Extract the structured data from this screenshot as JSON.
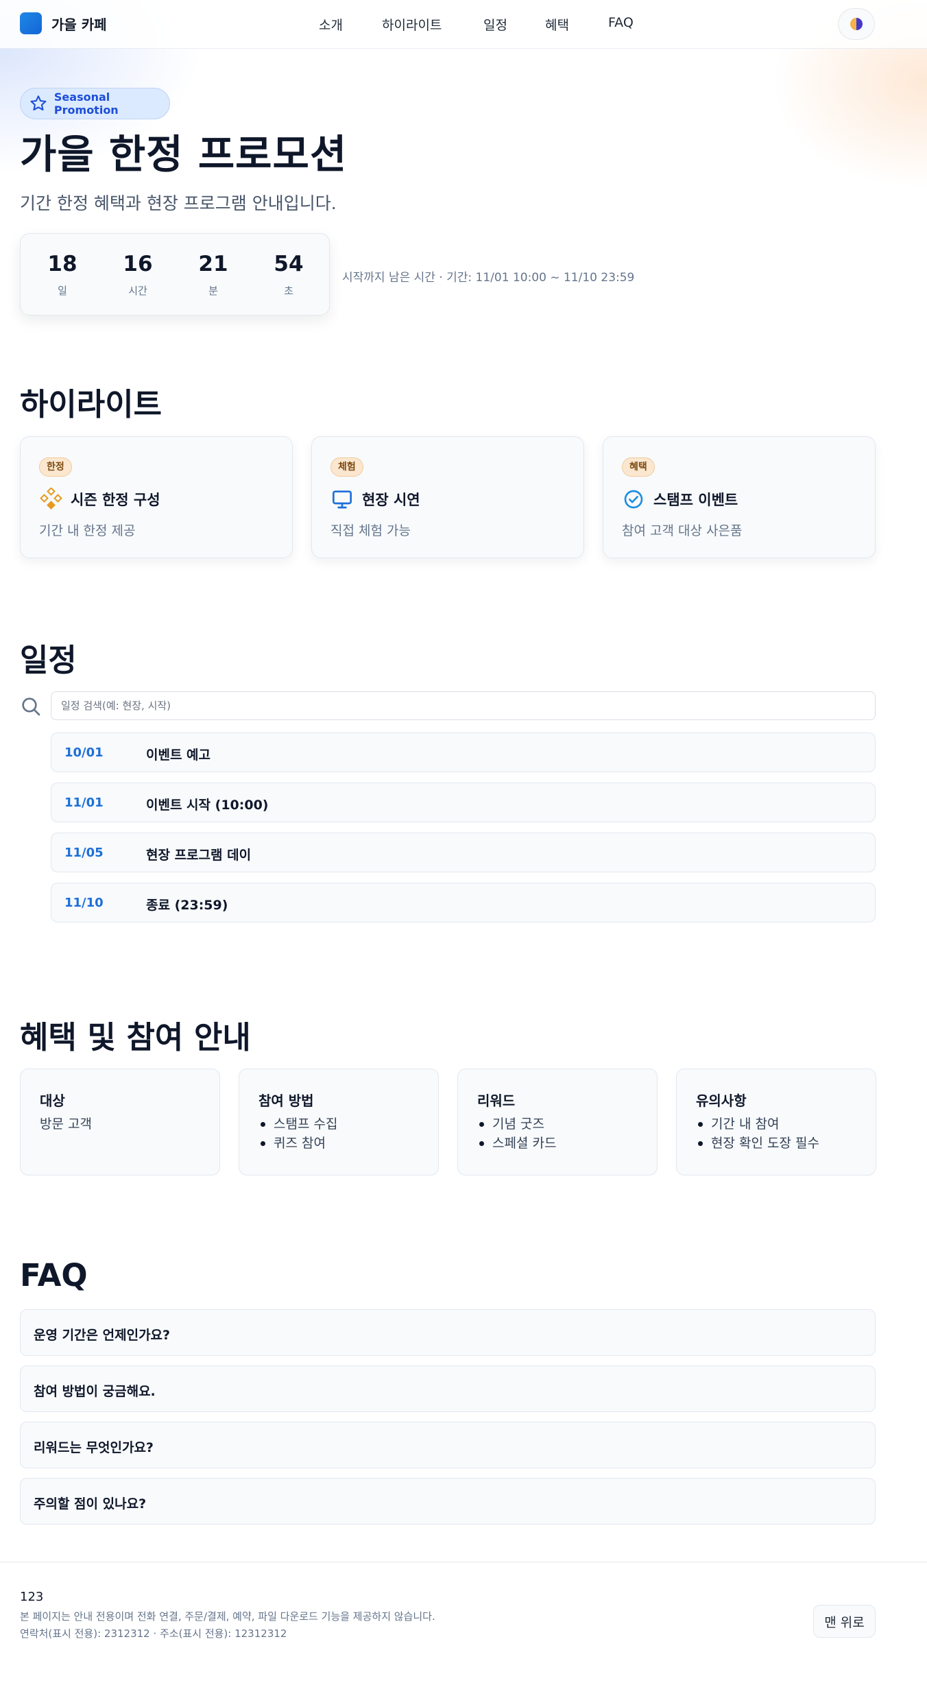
{
  "header": {
    "brand": "가을 카페",
    "nav": [
      "소개",
      "하이라이트",
      "일정",
      "혜택",
      "FAQ"
    ]
  },
  "hero": {
    "badge": "Seasonal Promotion",
    "title": "가을 한정 프로모션",
    "subtitle": "기간 한정 혜택과 현장 프로그램 안내입니다.",
    "countdown": [
      {
        "value": "18",
        "unit": "일"
      },
      {
        "value": "16",
        "unit": "시간"
      },
      {
        "value": "21",
        "unit": "분"
      },
      {
        "value": "54",
        "unit": "초"
      }
    ],
    "countdown_note": "시작까지 남은 시간 · 기간: 11/01 10:00 ~ 11/10 23:59"
  },
  "highlights": {
    "title": "하이라이트",
    "cards": [
      {
        "tag": "한정",
        "title": "시즌 한정 구성",
        "desc": "기간 내 한정 제공",
        "icon": "diamond-cluster-icon"
      },
      {
        "tag": "체험",
        "title": "현장 시연",
        "desc": "직접 체험 가능",
        "icon": "monitor-icon"
      },
      {
        "tag": "혜택",
        "title": "스탬프 이벤트",
        "desc": "참여 고객 대상 사은품",
        "icon": "check-circle-icon"
      }
    ]
  },
  "schedule": {
    "title": "일정",
    "search_placeholder": "일정 검색(예: 현장, 시작)",
    "items": [
      {
        "date": "10/01",
        "text": "이벤트 예고"
      },
      {
        "date": "11/01",
        "text": "이벤트 시작 (10:00)"
      },
      {
        "date": "11/05",
        "text": "현장 프로그램 데이"
      },
      {
        "date": "11/10",
        "text": "종료 (23:59)"
      }
    ]
  },
  "benefits": {
    "title": "혜택 및 참여 안내",
    "cards": [
      {
        "title": "대상",
        "text": "방문 고객",
        "items": []
      },
      {
        "title": "참여 방법",
        "items": [
          "스탬프 수집",
          "퀴즈 참여"
        ]
      },
      {
        "title": "리워드",
        "items": [
          "기념 굿즈",
          "스페셜 카드"
        ]
      },
      {
        "title": "유의사항",
        "items": [
          "기간 내 참여",
          "현장 확인 도장 필수"
        ]
      }
    ]
  },
  "faq": {
    "title": "FAQ",
    "items": [
      "운영 기간은 언제인가요?",
      "참여 방법이 궁금해요.",
      "리워드는 무엇인가요?",
      "주의할 점이 있나요?"
    ]
  },
  "footer": {
    "name": "123",
    "notice": "본 페이지는 안내 전용이며 전화 연결, 주문/결제, 예약, 파일 다운로드 기능을 제공하지 않습니다.",
    "contact": "연락처(표시 전용): 2312312 · 주소(표시 전용): 12312312",
    "top_button": "맨 위로"
  },
  "colors": {
    "accent": "#1d6fd8",
    "tag_bg": "#fbe7cf",
    "card_bg": "#f8fafc"
  }
}
